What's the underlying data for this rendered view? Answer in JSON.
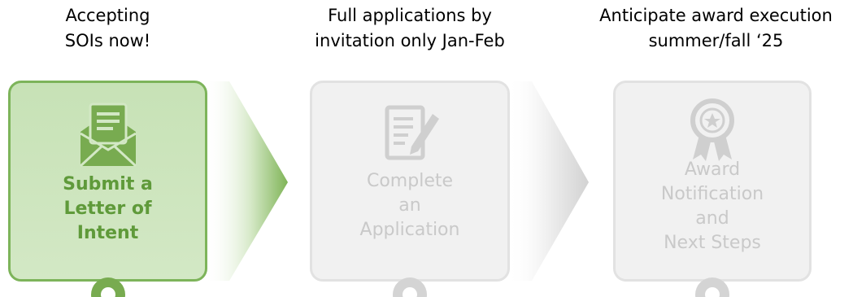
{
  "captions": [
    {
      "line1": "Accepting",
      "line2": "SOIs now!"
    },
    {
      "line1": "Full applications by",
      "line2": "invitation only Jan-Feb"
    },
    {
      "line1": "Anticipate award execution",
      "line2": "summer/fall ‘25"
    }
  ],
  "steps": [
    {
      "label_lines": [
        "Submit a",
        "Letter of",
        "Intent"
      ],
      "icon": "envelope-letter-icon",
      "state": "active"
    },
    {
      "label_lines": [
        "Complete",
        "an",
        "Application"
      ],
      "icon": "document-pencil-icon",
      "state": "inactive"
    },
    {
      "label_lines": [
        "Award",
        "Notification",
        "and",
        "Next Steps"
      ],
      "icon": "award-ribbon-icon",
      "state": "inactive"
    }
  ],
  "colors": {
    "active_fill": "#c7e2b6",
    "active_border": "#7db45a",
    "active_text": "#5f9a3a",
    "inactive_fill": "#f1f1f1",
    "inactive_border": "#e2e2e2",
    "inactive_text": "#c9c9c9"
  }
}
